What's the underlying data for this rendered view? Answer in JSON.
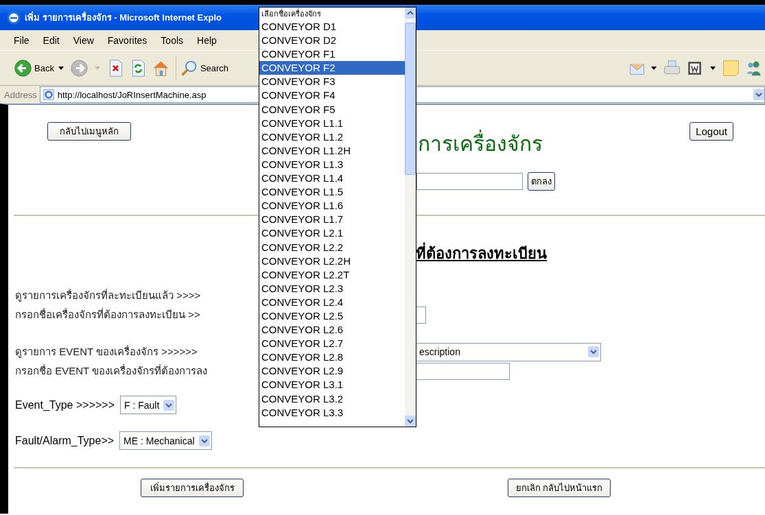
{
  "window": {
    "title": "เพิ่ม รายการเครื่องจักร - Microsoft Internet Explo"
  },
  "menu": [
    "File",
    "Edit",
    "View",
    "Favorites",
    "Tools",
    "Help"
  ],
  "toolbar": {
    "back_label": "Back",
    "search_label": "Search"
  },
  "address": {
    "label": "Address",
    "url": "http://localhost/JoRInsertMachine.asp"
  },
  "page": {
    "menu_button": "กลับไปเมนูหลัก",
    "logout_button": "Logout",
    "heading": "การเครื่องจักร",
    "ok_button": "ตกลง",
    "subheading": "ที่ต้องการลงทะเบียน"
  },
  "rows": [
    {
      "kind": "text",
      "label": "ดูรายการเครื่องจักรที่ละทะเบียนแล้ว >>>>"
    },
    {
      "kind": "input",
      "label": "กรอกชื่อเครื่องจักรที่ต้องการลงทะเบียน >>"
    },
    {
      "kind": "select",
      "label": "ดูรายการ EVENT ของเครื่องจักร >>>>>>",
      "value": "escription"
    },
    {
      "kind": "input-wide",
      "label": "กรอกชื่อ EVENT ของเครื่องจักรที่ต้องการลง"
    }
  ],
  "selects": [
    {
      "label": "Event_Type >>>>>>",
      "value": "F : Fault"
    },
    {
      "label": "Fault/Alarm_Type>>",
      "value": "ME : Mechanical"
    }
  ],
  "buttons": [
    "เพิ่มรายการเครื่องจักร",
    "ยกเลิก กลับไปหน้าแรก"
  ],
  "dropdown": {
    "items": [
      {
        "kind": "prompt",
        "label": "เลือกชื่อเครื่องจักร",
        "selected": false
      },
      {
        "kind": "option",
        "label": "CONVEYOR D1",
        "selected": false
      },
      {
        "kind": "option",
        "label": "CONVEYOR D2",
        "selected": false
      },
      {
        "kind": "option",
        "label": "CONVEYOR F1",
        "selected": false
      },
      {
        "kind": "option",
        "label": "CONVEYOR F2",
        "selected": true
      },
      {
        "kind": "option",
        "label": "CONVEYOR F3",
        "selected": false
      },
      {
        "kind": "option",
        "label": "CONVEYOR F4",
        "selected": false
      },
      {
        "kind": "option",
        "label": "CONVEYOR F5",
        "selected": false
      },
      {
        "kind": "option",
        "label": "CONVEYOR L1.1",
        "selected": false
      },
      {
        "kind": "option",
        "label": "CONVEYOR L1.2",
        "selected": false
      },
      {
        "kind": "option",
        "label": "CONVEYOR L1.2H",
        "selected": false
      },
      {
        "kind": "option",
        "label": "CONVEYOR L1.3",
        "selected": false
      },
      {
        "kind": "option",
        "label": "CONVEYOR L1.4",
        "selected": false
      },
      {
        "kind": "option",
        "label": "CONVEYOR L1.5",
        "selected": false
      },
      {
        "kind": "option",
        "label": "CONVEYOR L1.6",
        "selected": false
      },
      {
        "kind": "option",
        "label": "CONVEYOR L1.7",
        "selected": false
      },
      {
        "kind": "option",
        "label": "CONVEYOR L2.1",
        "selected": false
      },
      {
        "kind": "option",
        "label": "CONVEYOR L2.2",
        "selected": false
      },
      {
        "kind": "option",
        "label": "CONVEYOR L2.2H",
        "selected": false
      },
      {
        "kind": "option",
        "label": "CONVEYOR L2.2T",
        "selected": false
      },
      {
        "kind": "option",
        "label": "CONVEYOR L2.3",
        "selected": false
      },
      {
        "kind": "option",
        "label": "CONVEYOR L2.4",
        "selected": false
      },
      {
        "kind": "option",
        "label": "CONVEYOR L2.5",
        "selected": false
      },
      {
        "kind": "option",
        "label": "CONVEYOR L2.6",
        "selected": false
      },
      {
        "kind": "option",
        "label": "CONVEYOR L2.7",
        "selected": false
      },
      {
        "kind": "option",
        "label": "CONVEYOR L2.8",
        "selected": false
      },
      {
        "kind": "option",
        "label": "CONVEYOR L2.9",
        "selected": false
      },
      {
        "kind": "option",
        "label": "CONVEYOR L3.1",
        "selected": false
      },
      {
        "kind": "option",
        "label": "CONVEYOR L3.2",
        "selected": false
      },
      {
        "kind": "option",
        "label": "CONVEYOR L3.3",
        "selected": false
      }
    ]
  }
}
